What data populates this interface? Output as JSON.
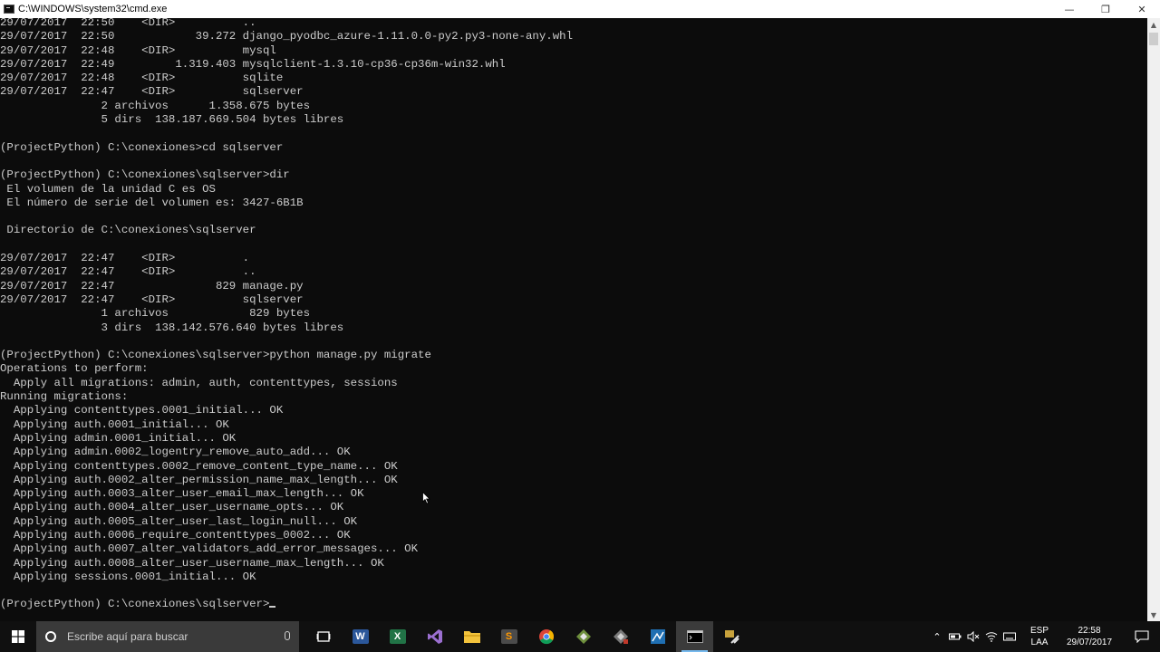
{
  "window": {
    "title": "C:\\WINDOWS\\system32\\cmd.exe",
    "minimize_glyph": "—",
    "restore_glyph": "❐",
    "close_glyph": "✕"
  },
  "console": {
    "lines": [
      "29/07/2017  22:50    <DIR>          ..",
      "29/07/2017  22:50            39.272 django_pyodbc_azure-1.11.0.0-py2.py3-none-any.whl",
      "29/07/2017  22:48    <DIR>          mysql",
      "29/07/2017  22:49         1.319.403 mysqlclient-1.3.10-cp36-cp36m-win32.whl",
      "29/07/2017  22:48    <DIR>          sqlite",
      "29/07/2017  22:47    <DIR>          sqlserver",
      "               2 archivos      1.358.675 bytes",
      "               5 dirs  138.187.669.504 bytes libres",
      "",
      "(ProjectPython) C:\\conexiones>cd sqlserver",
      "",
      "(ProjectPython) C:\\conexiones\\sqlserver>dir",
      " El volumen de la unidad C es OS",
      " El número de serie del volumen es: 3427-6B1B",
      "",
      " Directorio de C:\\conexiones\\sqlserver",
      "",
      "29/07/2017  22:47    <DIR>          .",
      "29/07/2017  22:47    <DIR>          ..",
      "29/07/2017  22:47               829 manage.py",
      "29/07/2017  22:47    <DIR>          sqlserver",
      "               1 archivos            829 bytes",
      "               3 dirs  138.142.576.640 bytes libres",
      "",
      "(ProjectPython) C:\\conexiones\\sqlserver>python manage.py migrate",
      "Operations to perform:",
      "  Apply all migrations: admin, auth, contenttypes, sessions",
      "Running migrations:",
      "  Applying contenttypes.0001_initial... OK",
      "  Applying auth.0001_initial... OK",
      "  Applying admin.0001_initial... OK",
      "  Applying admin.0002_logentry_remove_auto_add... OK",
      "  Applying contenttypes.0002_remove_content_type_name... OK",
      "  Applying auth.0002_alter_permission_name_max_length... OK",
      "  Applying auth.0003_alter_user_email_max_length... OK",
      "  Applying auth.0004_alter_user_username_opts... OK",
      "  Applying auth.0005_alter_user_last_login_null... OK",
      "  Applying auth.0006_require_contenttypes_0002... OK",
      "  Applying auth.0007_alter_validators_add_error_messages... OK",
      "  Applying auth.0008_alter_user_username_max_length... OK",
      "  Applying sessions.0001_initial... OK",
      ""
    ],
    "prompt": "(ProjectPython) C:\\conexiones\\sqlserver>"
  },
  "taskbar": {
    "search_placeholder": "Escribe aquí para buscar",
    "apps": [
      {
        "name": "task-view",
        "label": ""
      },
      {
        "name": "word",
        "label": "W",
        "color": "#2b579a"
      },
      {
        "name": "excel",
        "label": "X",
        "color": "#217346"
      },
      {
        "name": "visual-studio",
        "label": "",
        "color": "#68217a"
      },
      {
        "name": "file-explorer",
        "label": "",
        "color": "#f3c33c"
      },
      {
        "name": "sublime-text",
        "label": "S",
        "color": "#4b4b4b"
      },
      {
        "name": "chrome",
        "label": "",
        "color": "#db4437"
      },
      {
        "name": "app-green",
        "label": "",
        "color": "#6e8f3d"
      },
      {
        "name": "app-gray",
        "label": "",
        "color": "#7a7a7a"
      },
      {
        "name": "app-blue",
        "label": "",
        "color": "#1f6fb2"
      },
      {
        "name": "cmd",
        "label": "",
        "color": "#000000"
      },
      {
        "name": "app-tools",
        "label": "",
        "color": "#c8a23c"
      }
    ],
    "language": {
      "line1": "ESP",
      "line2": "LAA"
    },
    "clock": {
      "time": "22:58",
      "date": "29/07/2017"
    }
  }
}
